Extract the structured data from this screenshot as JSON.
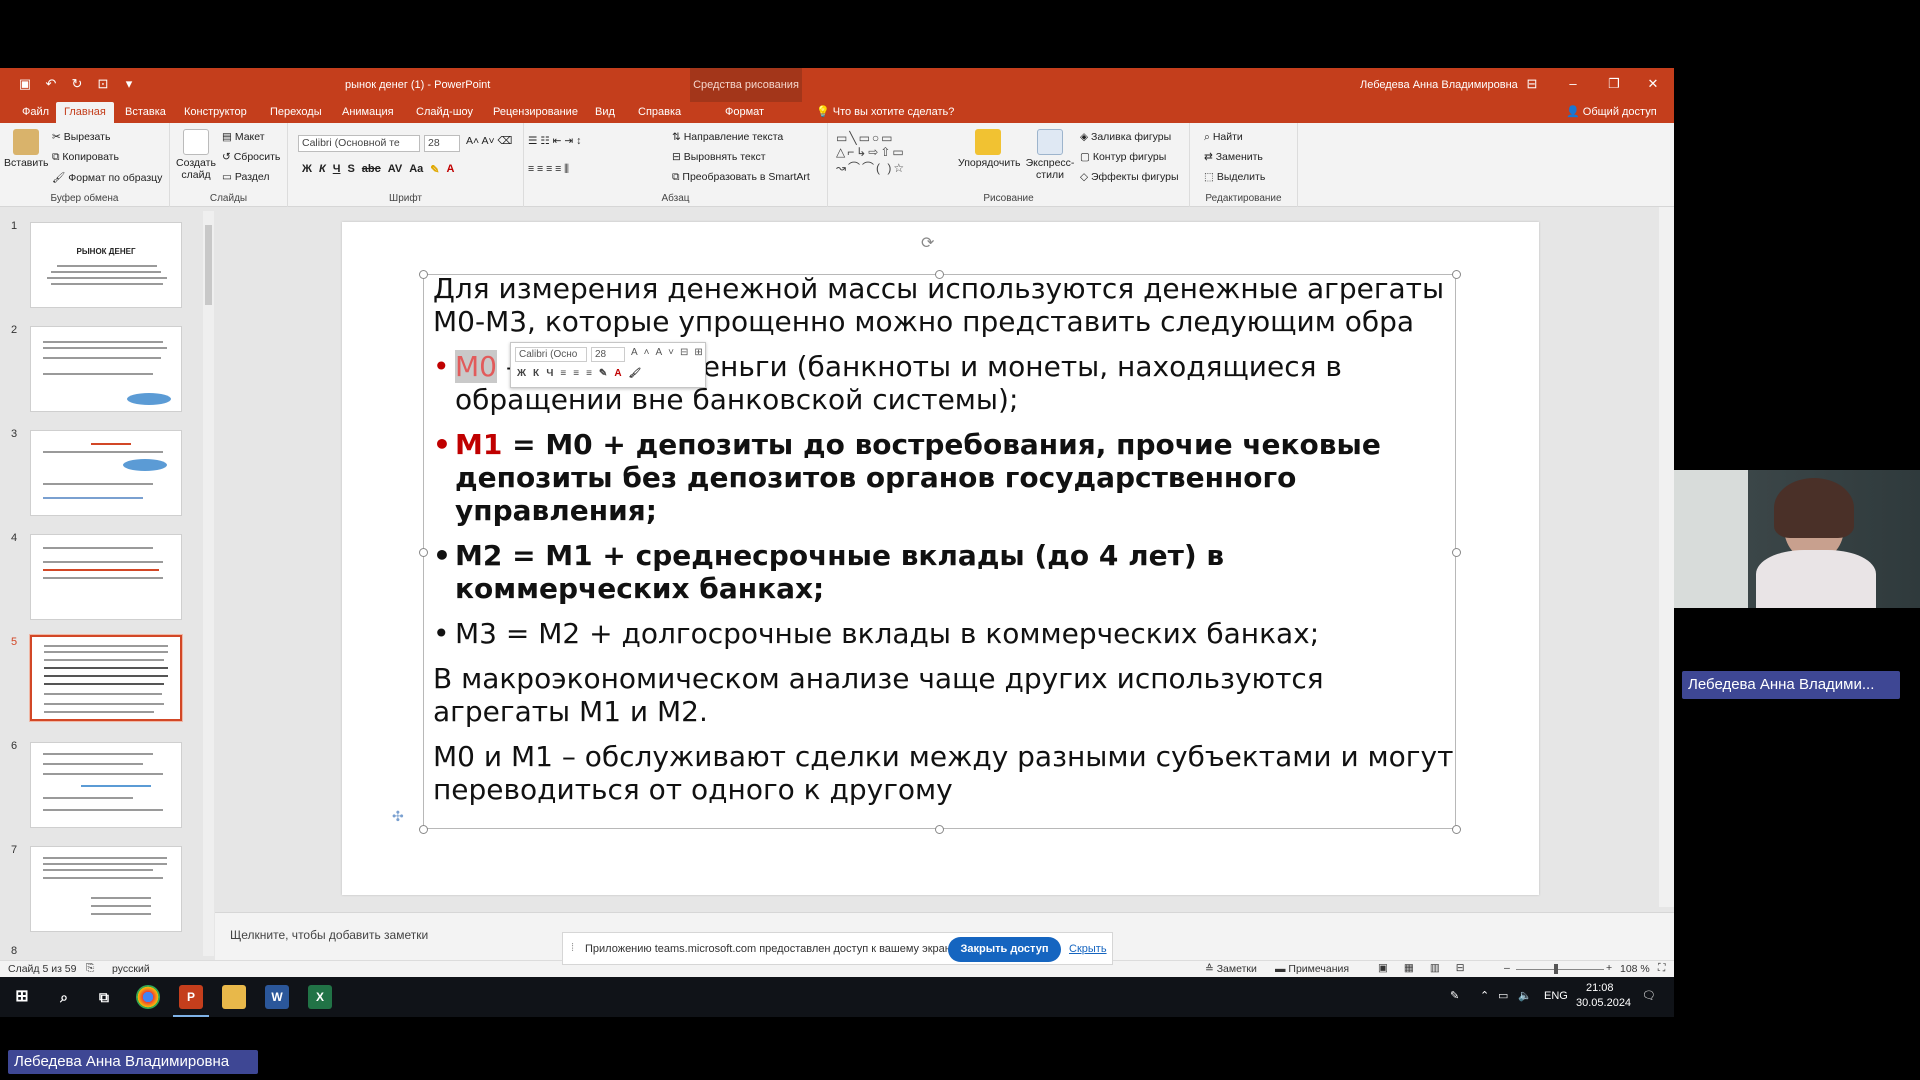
{
  "app": {
    "doc_title": "рынок денег (1)  -  PowerPoint",
    "context_tools": "Средства рисования",
    "user": "Лебедева Анна Владимировна"
  },
  "tabs": [
    "Файл",
    "Главная",
    "Вставка",
    "Конструктор",
    "Переходы",
    "Анимация",
    "Слайд-шоу",
    "Рецензирование",
    "Вид",
    "Справка",
    "Формат"
  ],
  "tell_me": "Что вы хотите сделать?",
  "share": "Общий доступ",
  "ribbon": {
    "clipboard": {
      "paste": "Вставить",
      "cut": "Вырезать",
      "copy": "Копировать",
      "painter": "Формат по образцу",
      "label": "Буфер обмена"
    },
    "slides": {
      "new": "Создать слайд",
      "layout": "Макет",
      "reset": "Сбросить",
      "section": "Раздел",
      "label": "Слайды"
    },
    "font": {
      "name": "Calibri (Основной те",
      "size": "28",
      "label": "Шрифт"
    },
    "paragraph": {
      "dir": "Направление текста",
      "align": "Выровнять текст",
      "smartart": "Преобразовать в SmartArt",
      "label": "Абзац"
    },
    "drawing": {
      "arrange": "Упорядочить",
      "quick": "Экспресс-стили",
      "fill": "Заливка фигуры",
      "outline": "Контур фигуры",
      "effects": "Эффекты фигуры",
      "label": "Рисование"
    },
    "editing": {
      "find": "Найти",
      "replace": "Заменить",
      "select": "Выделить",
      "label": "Редактирование"
    }
  },
  "thumbs": [
    {
      "num": "1",
      "title": "РЫНОК ДЕНЕГ"
    },
    {
      "num": "2",
      "title": ""
    },
    {
      "num": "3",
      "title": ""
    },
    {
      "num": "4",
      "title": ""
    },
    {
      "num": "5",
      "title": ""
    },
    {
      "num": "6",
      "title": ""
    },
    {
      "num": "7",
      "title": ""
    },
    {
      "num": "8",
      "title": ""
    }
  ],
  "slide": {
    "intro": "Для измерения денежной массы используются денежные агрегаты М0-М3, которые упрощенно можно представить следующим образом:",
    "intro_visible": "Для измерения денежной массы используются денежные агрегаты М0-М3, которые упрощенно можно представить следующим обра",
    "b1_key": "М0",
    "b1_text": " – наличные деньги (банкноты и монеты, находящиеся в обращении вне банковской системы);",
    "b2_key": "М1",
    "b2_text": " = М0 + депозиты до востребования, прочие чековые депозиты без депозитов органов государственного управления;",
    "b3_text": "М2 = М1 + среднесрочные вклады (до 4 лет) в коммерческих банках;",
    "b4_text": "М3 = М2 + долгосрочные вклады в коммерческих банках;",
    "p2": "В макроэкономическом анализе чаще других используются агрегаты М1 и М2.",
    "p3": "М0 и М1 – обслуживают сделки между разными субъектами и могут переводиться от одного к другому"
  },
  "minitb": {
    "font": "Calibri (Осно",
    "size": "28"
  },
  "notes_placeholder": "Щелкните, чтобы добавить заметки",
  "notification": {
    "message": "Приложению teams.microsoft.com предоставлен доступ к вашему экрану.",
    "stop": "Закрыть доступ",
    "hide": "Скрыть"
  },
  "status": {
    "slide": "Слайд 5 из 59",
    "lang": "русский",
    "notes": "Заметки",
    "comments": "Примечания",
    "zoom": "108 %"
  },
  "tray": {
    "lang": "ENG",
    "time": "21:08",
    "date": "30.05.2024"
  },
  "participant": "Лебедева Анна Владими...",
  "presenter": "Лебедева Анна Владимировна",
  "colors": {
    "accent": "#c43e1c",
    "teams": "#3e4794",
    "link": "#1565c0",
    "red": "#c00000"
  }
}
